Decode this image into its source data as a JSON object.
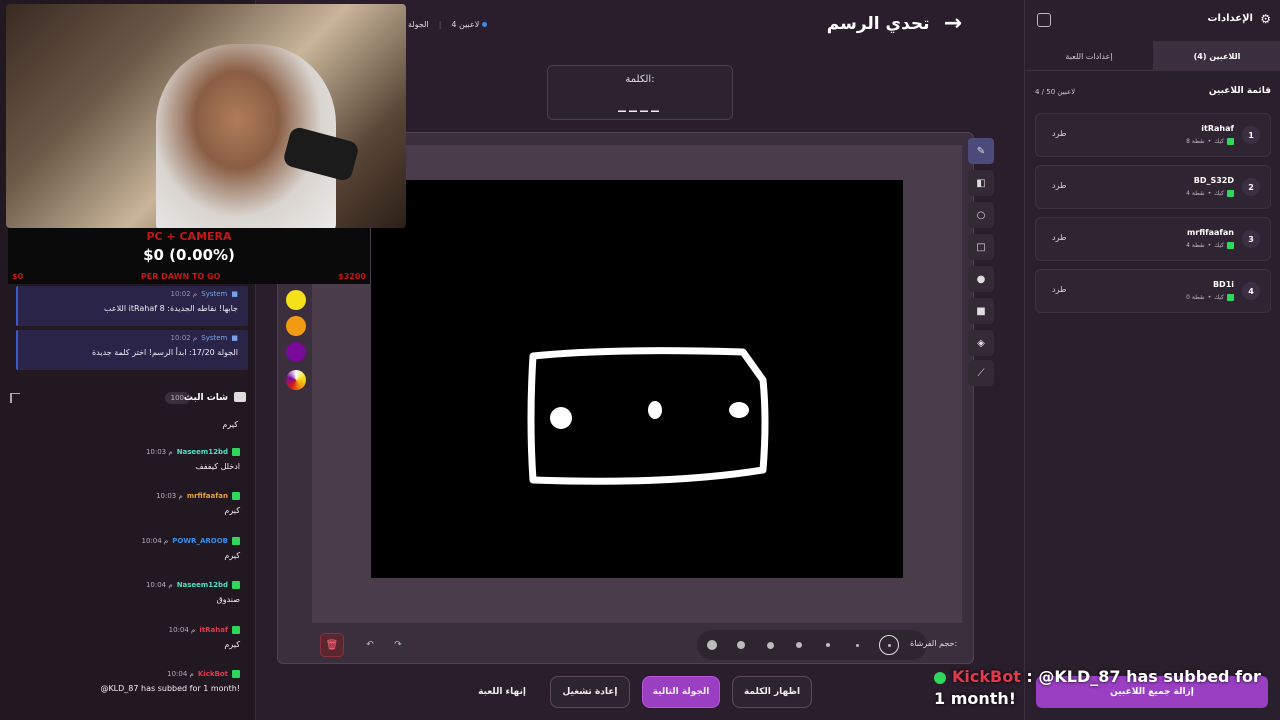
{
  "donation": {
    "header": "PC + CAMERA",
    "amount": "$0 (0.00%)",
    "left": "$0",
    "middle": "PER DAWN TO GO",
    "right": "$3200"
  },
  "system_messages": [
    {
      "time": "10:02 م",
      "sender": "System",
      "text": "اللاعب itRahaf جابها! نقاطه الجديدة: 8"
    },
    {
      "time": "10:02 م",
      "sender": "System",
      "text": "الجولة 17/20: ابدأ الرسم! اختر كلمة جديدة"
    }
  ],
  "chat": {
    "title": "شات البث",
    "count": "100",
    "first_line": "كيرم",
    "messages": [
      {
        "time": "10:03 م",
        "user": "Naseem12bd",
        "user_color": "#4fe0c0",
        "text": "ادخلل كيففف"
      },
      {
        "time": "10:03 م",
        "user": "mrfifaafan",
        "user_color": "#e8a23a",
        "text": "كيرم"
      },
      {
        "time": "10:04 م",
        "user": "POWR_AROOB",
        "user_color": "#3a8ee8",
        "text": "كيرم"
      },
      {
        "time": "10:04 م",
        "user": "Naseem12bd",
        "user_color": "#4fe0c0",
        "text": "صندوق"
      },
      {
        "time": "10:04 م",
        "user": "itRahaf",
        "user_color": "#e23a4a",
        "text": "كيرم"
      },
      {
        "time": "10:04 م",
        "user": "KickBot",
        "user_color": "#e23a4a",
        "text": "@KLD_87 has subbed for 1 month!"
      }
    ]
  },
  "topbar": {
    "round": "الجولة",
    "players": "4 لاعبين",
    "title": "تحدي الرسم",
    "back_icon": "arrow-right-icon"
  },
  "word": {
    "label": "الكلمة:",
    "blanks": "____"
  },
  "tools": [
    "pen-icon",
    "eraser-icon",
    "circle-icon",
    "square-icon",
    "filled-circle-icon",
    "filled-square-icon",
    "fill-bucket-icon",
    "line-icon"
  ],
  "palette": [
    "#d11a1a",
    "#1fb52b",
    "#1034e8",
    "#f5e11a",
    "#f29a12",
    "#7a0a9a"
  ],
  "brush": {
    "label": "حجم الفرشاة:",
    "sizes": [
      10,
      8,
      6,
      5,
      4,
      3,
      2
    ]
  },
  "actions": {
    "end_game": "إنهاء اللعبة",
    "restart": "إعادة تشغيل",
    "next_round": "الجولة التالية",
    "reveal_word": "اظهار الكلمة"
  },
  "settings": {
    "title": "الإعدادات",
    "tabs": [
      "اللاعبين (4)",
      "إعدادات اللعبة"
    ],
    "list_title": "قائمة اللاعبين",
    "list_count": "4 / 50 لاعبين",
    "kick_label": "طرد",
    "remove_all": "إزالة جميع اللاعبين",
    "players": [
      {
        "rank": "1",
        "name": "itRahaf",
        "points": "8 نقطة",
        "platform": "كيك"
      },
      {
        "rank": "2",
        "name": "BD_S32D",
        "points": "4 نقطة",
        "platform": "كيك"
      },
      {
        "rank": "3",
        "name": "mrfifaafan",
        "points": "4 نقطة",
        "platform": "كيك"
      },
      {
        "rank": "4",
        "name": "BD1i",
        "points": "0 نقطة",
        "platform": "كيك"
      }
    ]
  },
  "overlay": {
    "bot": "KickBot",
    "text": ": @KLD_87 has subbed for 1 month!"
  }
}
